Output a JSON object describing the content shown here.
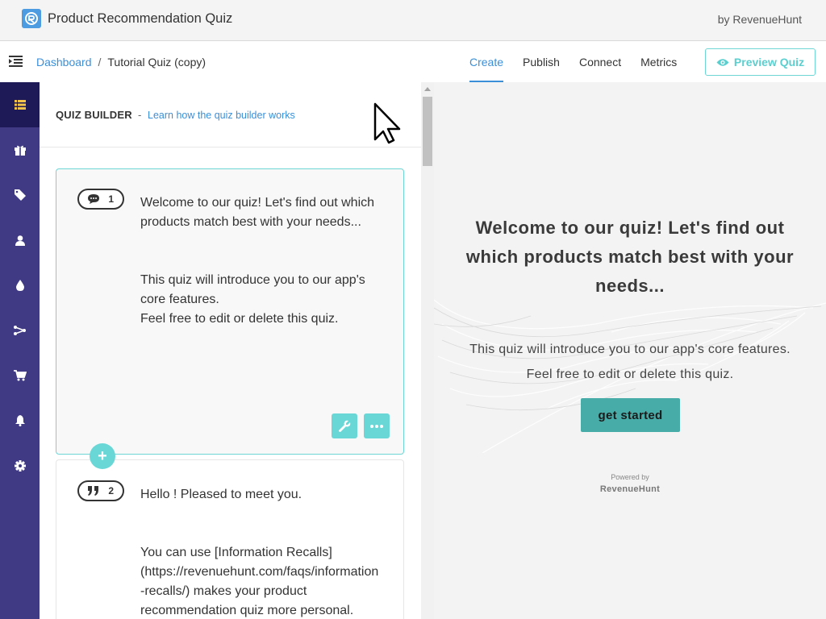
{
  "header": {
    "title": "Product Recommendation Quiz",
    "by_line": "by RevenueHunt"
  },
  "breadcrumb": {
    "root": "Dashboard",
    "separator": "/",
    "current": "Tutorial Quiz (copy)"
  },
  "tabs": [
    {
      "label": "Create",
      "active": true
    },
    {
      "label": "Publish",
      "active": false
    },
    {
      "label": "Connect",
      "active": false
    },
    {
      "label": "Metrics",
      "active": false
    }
  ],
  "preview_button": {
    "label": "Preview Quiz"
  },
  "sidebar": {
    "items": [
      {
        "icon": "list-icon",
        "active": true
      },
      {
        "icon": "gift-icon",
        "active": false
      },
      {
        "icon": "tag-icon",
        "active": false
      },
      {
        "icon": "user-icon",
        "active": false
      },
      {
        "icon": "drop-icon",
        "active": false
      },
      {
        "icon": "flow-icon",
        "active": false
      },
      {
        "icon": "cart-icon",
        "active": false
      },
      {
        "icon": "bell-icon",
        "active": false
      },
      {
        "icon": "gear-icon",
        "active": false
      }
    ]
  },
  "builder": {
    "title": "QUIZ BUILDER",
    "dash": "-",
    "help_link": "Learn how the quiz builder works",
    "cards": [
      {
        "number": "1",
        "icon": "speech-bubble-icon",
        "lines": [
          "Welcome to our quiz! Let's find out which",
          "products match best with your needs...",
          "",
          "",
          "This quiz will introduce you to our app's",
          "core features.",
          "Feel free to edit or delete this quiz."
        ]
      },
      {
        "number": "2",
        "icon": "quote-icon",
        "lines": [
          "Hello ! Pleased to meet you.",
          "",
          "",
          "You can use [Information Recalls]",
          "(https://revenuehunt.com/faqs/information",
          "-recalls/) makes your product",
          "recommendation quiz more personal."
        ]
      }
    ],
    "add_label": "+"
  },
  "preview": {
    "title_lines": [
      "Welcome to our quiz! Let's find out",
      "which products match best with your",
      "needs..."
    ],
    "desc_lines": [
      "This quiz will introduce you to our app's core features.",
      "Feel free to edit or delete this quiz."
    ],
    "button": "get started",
    "powered_by": "Powered by",
    "brand": "RevenueHunt"
  },
  "colors": {
    "accent": "#3b8fd8",
    "teal": "#6ad7d7",
    "sidebar": "#3f3a83",
    "sidebar_active": "#1e1a57",
    "cta": "#47aca8"
  }
}
